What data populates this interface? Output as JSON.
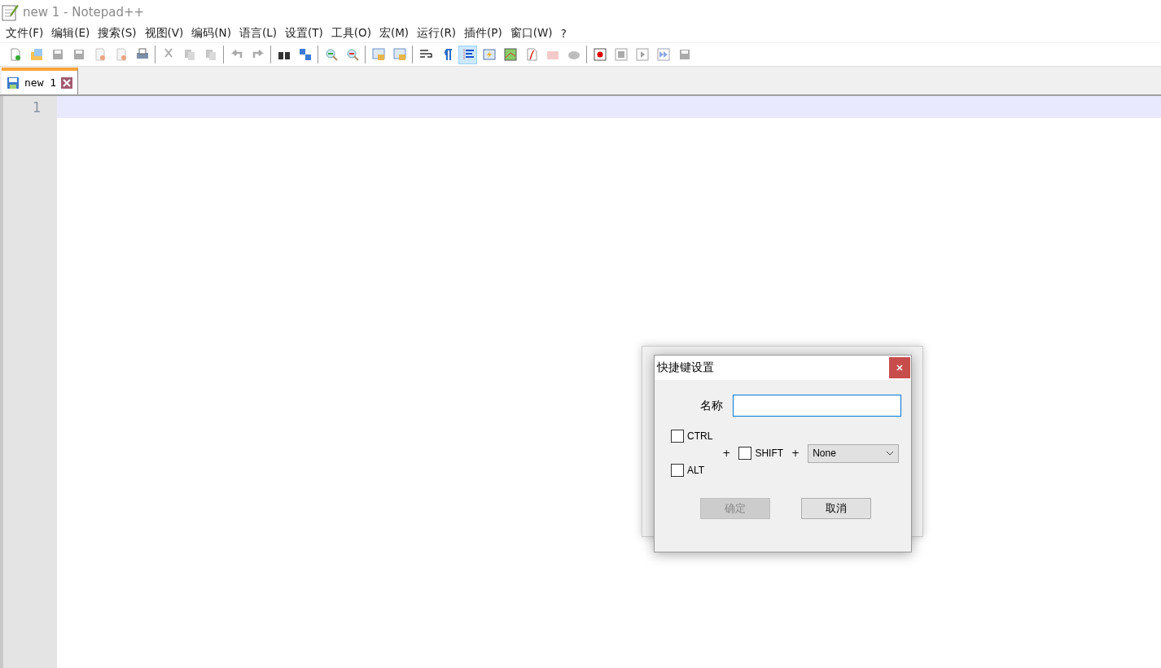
{
  "window": {
    "title": "new 1 - Notepad++"
  },
  "menu": [
    {
      "label": "文件(F)"
    },
    {
      "label": "编辑(E)"
    },
    {
      "label": "搜索(S)"
    },
    {
      "label": "视图(V)"
    },
    {
      "label": "编码(N)"
    },
    {
      "label": "语言(L)"
    },
    {
      "label": "设置(T)"
    },
    {
      "label": "工具(O)"
    },
    {
      "label": "宏(M)"
    },
    {
      "label": "运行(R)"
    },
    {
      "label": "插件(P)"
    },
    {
      "label": "窗口(W)"
    },
    {
      "label": "?"
    }
  ],
  "toolbar": [
    [
      {
        "selected": false,
        "disabled": false
      },
      {
        "selected": false,
        "disabled": false
      },
      {
        "selected": false,
        "disabled": true
      },
      {
        "selected": false,
        "disabled": true
      },
      {
        "selected": false,
        "disabled": true
      },
      {
        "selected": false,
        "disabled": true
      },
      {
        "selected": false,
        "disabled": false
      }
    ],
    [
      {
        "selected": false,
        "disabled": true
      },
      {
        "selected": false,
        "disabled": true
      },
      {
        "selected": false,
        "disabled": true
      }
    ],
    [
      {
        "selected": false,
        "disabled": true
      },
      {
        "selected": false,
        "disabled": true
      }
    ],
    [
      {
        "selected": false,
        "disabled": false
      },
      {
        "selected": false,
        "disabled": false
      }
    ],
    [
      {
        "selected": false,
        "disabled": false
      },
      {
        "selected": false,
        "disabled": false
      }
    ],
    [
      {
        "selected": false,
        "disabled": false
      },
      {
        "selected": false,
        "disabled": false
      }
    ],
    [
      {
        "selected": false,
        "disabled": false
      },
      {
        "selected": false,
        "disabled": false
      },
      {
        "selected": true,
        "disabled": false
      },
      {
        "selected": false,
        "disabled": false
      },
      {
        "selected": false,
        "disabled": false
      },
      {
        "selected": false,
        "disabled": false
      },
      {
        "selected": false,
        "disabled": true
      },
      {
        "selected": false,
        "disabled": true
      }
    ],
    [
      {
        "selected": false,
        "disabled": false
      },
      {
        "selected": false,
        "disabled": true
      },
      {
        "selected": false,
        "disabled": true
      },
      {
        "selected": false,
        "disabled": true
      },
      {
        "selected": false,
        "disabled": true
      }
    ]
  ],
  "tabs": [
    {
      "label": "new 1",
      "selected": true
    }
  ],
  "editor": {
    "line_numbers": [
      "1"
    ]
  },
  "dialog": {
    "title": "快捷键设置",
    "name_label": "名称",
    "modifiers": [
      {
        "label": "CTRL",
        "checked": false
      },
      {
        "label": "ALT",
        "checked": false
      },
      {
        "label": "SHIFT",
        "checked": false
      }
    ],
    "plus_signs": [
      "+",
      "+"
    ],
    "key_select": {
      "value": "None"
    },
    "buttons": [
      {
        "label": "确定",
        "disabled": true
      },
      {
        "label": "取消",
        "disabled": false
      }
    ]
  }
}
